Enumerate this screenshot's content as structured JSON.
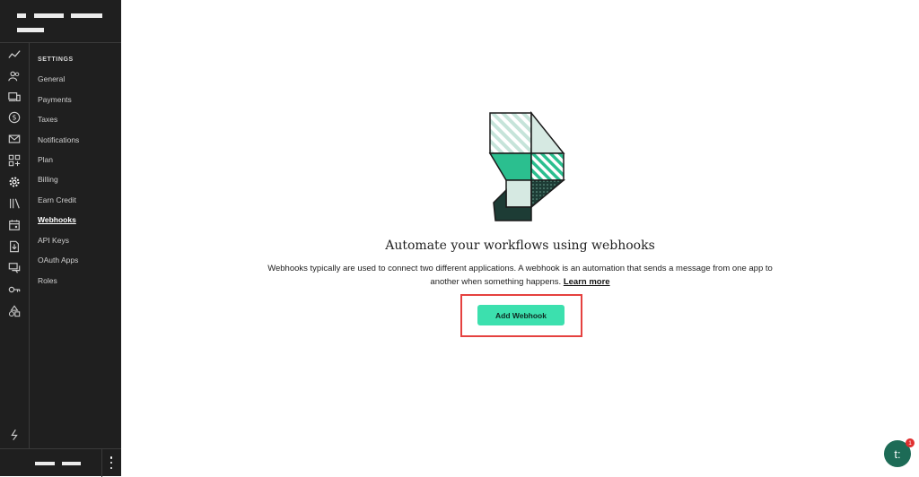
{
  "sidebar": {
    "heading": "SETTINGS",
    "items": [
      {
        "label": "General"
      },
      {
        "label": "Payments"
      },
      {
        "label": "Taxes"
      },
      {
        "label": "Notifications"
      },
      {
        "label": "Plan"
      },
      {
        "label": "Billing"
      },
      {
        "label": "Earn Credit"
      },
      {
        "label": "Webhooks",
        "active": true
      },
      {
        "label": "API Keys"
      },
      {
        "label": "OAuth Apps"
      },
      {
        "label": "Roles"
      }
    ],
    "rail_icons": [
      "analytics-icon",
      "customers-icon",
      "devices-icon",
      "dollar-icon",
      "mail-icon",
      "apps-icon",
      "settings-gear-icon",
      "library-icon",
      "calendar-icon",
      "download-file-icon",
      "chat-icon",
      "key-icon",
      "shapes-icon",
      "lightning-icon"
    ]
  },
  "empty_state": {
    "title": "Automate your workflows using webhooks",
    "description": "Webhooks typically are used to connect two different applications. A webhook is an automation that sends a message from one app to another when something happens.",
    "learn_more": "Learn more",
    "button_label": "Add Webhook"
  },
  "chat": {
    "icon_text": "t:",
    "badge_count": "1"
  },
  "colors": {
    "sidebar_bg": "#1f1f1f",
    "accent": "#3ce0ae",
    "highlight": "#e5413f",
    "chat": "#1d6b56"
  }
}
